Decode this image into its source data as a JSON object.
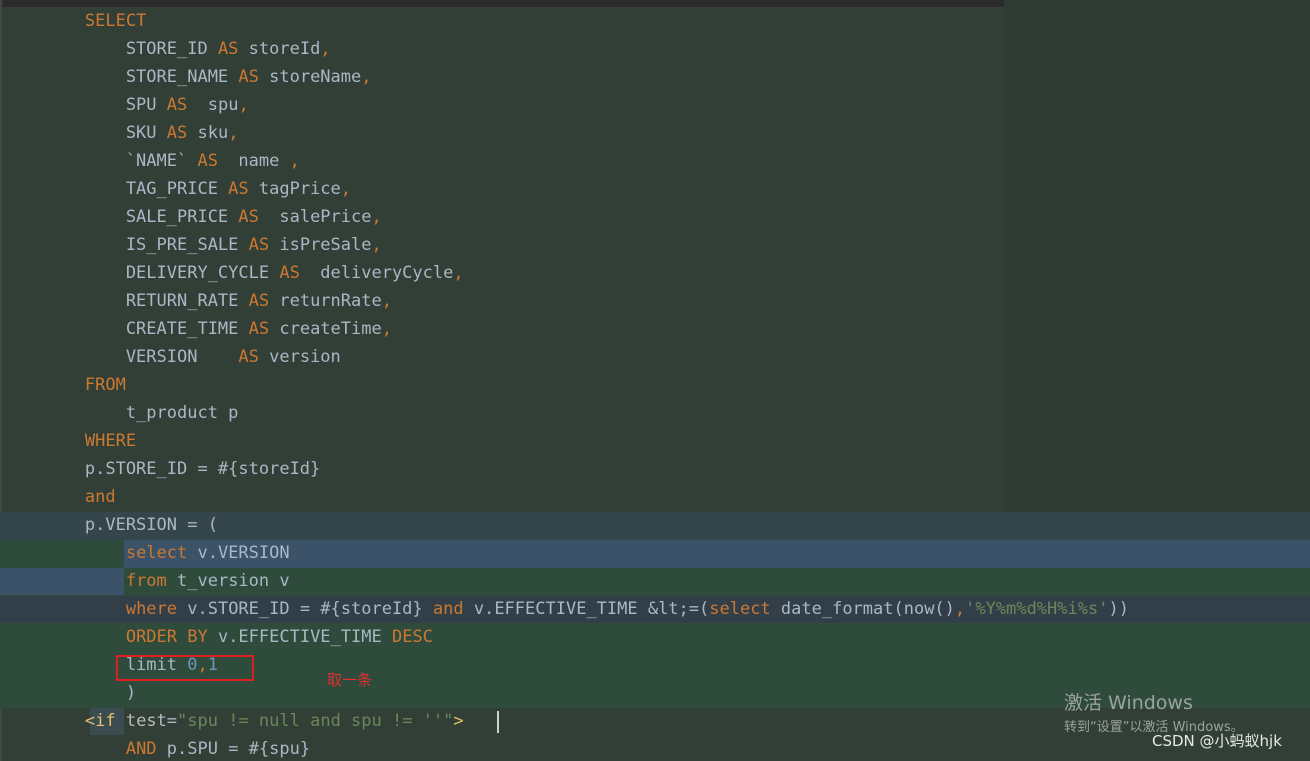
{
  "colors": {
    "background": "#323f36",
    "keyword": "#cc7832",
    "identifier": "#a9b7c6",
    "number": "#6897bb",
    "string": "#6a8759",
    "selection": "#3c5268",
    "highlight_box": "#e02020"
  },
  "code_lines": [
    [
      {
        "t": "        "
      },
      {
        "t": "SELECT",
        "k": "kw"
      }
    ],
    [
      {
        "t": "            STORE_ID "
      },
      {
        "t": "AS",
        "k": "kw"
      },
      {
        "t": " storeId"
      },
      {
        "t": ",",
        "k": "kw"
      }
    ],
    [
      {
        "t": "            STORE_NAME "
      },
      {
        "t": "AS",
        "k": "kw"
      },
      {
        "t": " storeName"
      },
      {
        "t": ",",
        "k": "kw"
      }
    ],
    [
      {
        "t": "            SPU "
      },
      {
        "t": "AS",
        "k": "kw"
      },
      {
        "t": "  spu"
      },
      {
        "t": ",",
        "k": "kw"
      }
    ],
    [
      {
        "t": "            SKU "
      },
      {
        "t": "AS",
        "k": "kw"
      },
      {
        "t": " sku"
      },
      {
        "t": ",",
        "k": "kw"
      }
    ],
    [
      {
        "t": "            `NAME` "
      },
      {
        "t": "AS",
        "k": "kw"
      },
      {
        "t": "  name "
      },
      {
        "t": ",",
        "k": "kw"
      }
    ],
    [
      {
        "t": "            TAG_PRICE "
      },
      {
        "t": "AS",
        "k": "kw"
      },
      {
        "t": " tagPrice"
      },
      {
        "t": ",",
        "k": "kw"
      }
    ],
    [
      {
        "t": "            SALE_PRICE "
      },
      {
        "t": "AS",
        "k": "kw"
      },
      {
        "t": "  salePrice"
      },
      {
        "t": ",",
        "k": "kw"
      }
    ],
    [
      {
        "t": "            IS_PRE_SALE "
      },
      {
        "t": "AS",
        "k": "kw"
      },
      {
        "t": " isPreSale"
      },
      {
        "t": ",",
        "k": "kw"
      }
    ],
    [
      {
        "t": "            DELIVERY_CYCLE "
      },
      {
        "t": "AS",
        "k": "kw"
      },
      {
        "t": "  deliveryCycle"
      },
      {
        "t": ",",
        "k": "kw"
      }
    ],
    [
      {
        "t": "            RETURN_RATE "
      },
      {
        "t": "AS",
        "k": "kw"
      },
      {
        "t": " returnRate"
      },
      {
        "t": ",",
        "k": "kw"
      }
    ],
    [
      {
        "t": "            CREATE_TIME "
      },
      {
        "t": "AS",
        "k": "kw"
      },
      {
        "t": " createTime"
      },
      {
        "t": ",",
        "k": "kw"
      }
    ],
    [
      {
        "t": "            VERSION    "
      },
      {
        "t": "AS",
        "k": "kw"
      },
      {
        "t": " version"
      }
    ],
    [
      {
        "t": "        "
      },
      {
        "t": "FROM",
        "k": "kw"
      }
    ],
    [
      {
        "t": "            t_product p"
      }
    ],
    [
      {
        "t": "        "
      },
      {
        "t": "WHERE",
        "k": "kw"
      }
    ],
    [
      {
        "t": "        p.STORE_ID = #{storeId}"
      }
    ],
    [
      {
        "t": "        "
      },
      {
        "t": "and",
        "k": "kw"
      }
    ],
    [
      {
        "t": "        p.VERSION = ("
      }
    ],
    [
      {
        "t": "            "
      },
      {
        "t": "select",
        "k": "kw"
      },
      {
        "t": " v.VERSION"
      }
    ],
    [
      {
        "t": "            "
      },
      {
        "t": "from",
        "k": "kw"
      },
      {
        "t": " t_version v"
      }
    ],
    [
      {
        "t": "            "
      },
      {
        "t": "where",
        "k": "kw"
      },
      {
        "t": " v.STORE_ID = #{storeId} "
      },
      {
        "t": "and",
        "k": "kw"
      },
      {
        "t": " v.EFFECTIVE_TIME &lt;=("
      },
      {
        "t": "select",
        "k": "kw"
      },
      {
        "t": " date_format(now()"
      },
      {
        "t": ",",
        "k": "kw"
      },
      {
        "t": "'%Y%m%d%H%i%s'",
        "k": "sqlstr"
      },
      {
        "t": "))"
      }
    ],
    [
      {
        "t": "            "
      },
      {
        "t": "ORDER BY",
        "k": "kw"
      },
      {
        "t": " v.EFFECTIVE_TIME "
      },
      {
        "t": "DESC",
        "k": "kw"
      }
    ],
    [
      {
        "t": "            limit "
      },
      {
        "t": "0",
        "k": "num"
      },
      {
        "t": ",",
        "k": "kw"
      },
      {
        "t": "1",
        "k": "num"
      }
    ],
    [
      {
        "t": "            )"
      }
    ],
    [
      {
        "t": "        "
      },
      {
        "t": "<if",
        "k": "tag"
      },
      {
        "t": " test",
        "k": "attr"
      },
      {
        "t": "=",
        "k": "id"
      },
      {
        "t": "\"spu != null and spu != ''\"",
        "k": "str"
      },
      {
        "t": ">",
        "k": "tag"
      }
    ],
    [
      {
        "t": "            "
      },
      {
        "t": "AND",
        "k": "kw"
      },
      {
        "t": " p.SPU = #{spu}"
      }
    ]
  ],
  "annotation": "取一条",
  "windows_activation": {
    "title": "激活 Windows",
    "subtitle": "转到“设置”以激活 Windows。"
  },
  "watermark": "CSDN @小蚂蚁hjk"
}
